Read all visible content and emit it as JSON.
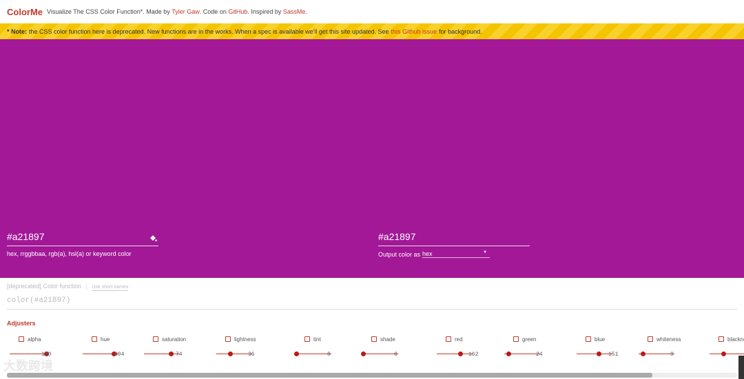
{
  "header": {
    "logo": "ColorMe",
    "tagline": "Visualize The CSS Color Function*. Made by",
    "author": "Tyler Gaw",
    "code_on": ". Code on",
    "github": "GitHub",
    "inspired": ". Inspired by",
    "sassme": "SassMe",
    "end": "."
  },
  "notice": {
    "bold": "* Note:",
    "text": "the CSS color function here is deprecated. New functions are in the works. When a spec is available we'll get this site updated. See",
    "link": "this Github issue",
    "tail": "for background."
  },
  "preview": {
    "color": "#a21897"
  },
  "input": {
    "value": "#a21897",
    "hint": "hex, rrggbbaa, rgb(a), hsl(a) or keyword color"
  },
  "output": {
    "value": "#a21897",
    "label": "Output color as",
    "format": "hex"
  },
  "func": {
    "title": "[deprecated] Color function",
    "short_names": "Use short names",
    "code": "color(#a21897)"
  },
  "adjusters": {
    "title": "Adjusters",
    "items": [
      {
        "name": "alpha",
        "value": "100",
        "frac": 1.0
      },
      {
        "name": "hue",
        "value": "304",
        "frac": 0.844
      },
      {
        "name": "saturation",
        "value": "74",
        "frac": 0.74
      },
      {
        "name": "lightness",
        "value": "36",
        "frac": 0.36
      },
      {
        "name": "tint",
        "value": "0",
        "frac": 0
      },
      {
        "name": "shade",
        "value": "0",
        "frac": 0
      },
      {
        "name": "red",
        "value": "162",
        "frac": 0.635
      },
      {
        "name": "green",
        "value": "24",
        "frac": 0.094
      },
      {
        "name": "blue",
        "value": "151",
        "frac": 0.592
      },
      {
        "name": "whiteness",
        "value": "9",
        "frac": 0.09
      },
      {
        "name": "blackne",
        "value": "",
        "frac": 0.36
      }
    ]
  },
  "watermark": "大数跨境"
}
